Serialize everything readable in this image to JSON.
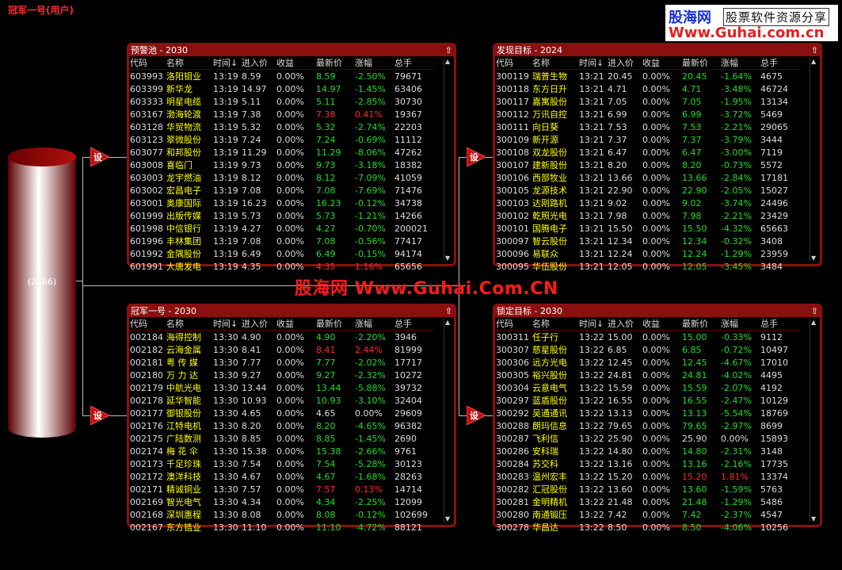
{
  "app_title": "冠军一号(用户)",
  "brand": {
    "name": "股海网",
    "slogan": "股票软件资源分享",
    "url": "Www.Guhai.com.cn"
  },
  "watermark": "股海网 Www.Guhai.Com.CN",
  "cylinder_count": "(2466)",
  "set_label": "设",
  "columns": [
    "代码",
    "名称",
    "时间↓",
    "进入价",
    "收益",
    "最新价",
    "涨幅",
    "总手"
  ],
  "panels": [
    {
      "title": "预警池 - 2030",
      "rows": [
        [
          "603993",
          "洛阳钼业",
          "13:19",
          "8.59",
          "0.00%",
          "8.59",
          "-2.50%",
          "79671"
        ],
        [
          "603399",
          "新华龙",
          "13:19",
          "14.97",
          "0.00%",
          "14.97",
          "-1.45%",
          "63406"
        ],
        [
          "603333",
          "明星电缆",
          "13:19",
          "5.11",
          "0.00%",
          "5.11",
          "-2.85%",
          "30730"
        ],
        [
          "603167",
          "渤海轮渡",
          "13:19",
          "7.38",
          "0.00%",
          "7.38",
          "0.41%",
          "19367"
        ],
        [
          "603128",
          "华贸物流",
          "13:19",
          "5.32",
          "0.00%",
          "5.32",
          "-2.74%",
          "22203"
        ],
        [
          "603123",
          "翠微股份",
          "13:19",
          "7.24",
          "0.00%",
          "7.24",
          "-0.69%",
          "11112"
        ],
        [
          "603077",
          "和邦股份",
          "13:19",
          "11.29",
          "0.00%",
          "11.29",
          "-8.06%",
          "47262"
        ],
        [
          "603008",
          "喜临门",
          "13:19",
          "9.73",
          "0.00%",
          "9.73",
          "-3.18%",
          "18382"
        ],
        [
          "603003",
          "龙宇燃油",
          "13:19",
          "8.12",
          "0.00%",
          "8.12",
          "-7.09%",
          "41059"
        ],
        [
          "603002",
          "宏昌电子",
          "13:19",
          "7.08",
          "0.00%",
          "7.08",
          "-7.69%",
          "71476"
        ],
        [
          "603001",
          "奥康国际",
          "13:19",
          "16.23",
          "0.00%",
          "16.23",
          "-0.12%",
          "34738"
        ],
        [
          "601999",
          "出版传媒",
          "13:19",
          "5.73",
          "0.00%",
          "5.73",
          "-1.21%",
          "14266"
        ],
        [
          "601998",
          "中信银行",
          "13:19",
          "4.27",
          "0.00%",
          "4.27",
          "-0.70%",
          "200021"
        ],
        [
          "601996",
          "丰林集团",
          "13:19",
          "7.08",
          "0.00%",
          "7.08",
          "-0.56%",
          "77417"
        ],
        [
          "601992",
          "金隅股份",
          "13:19",
          "6.49",
          "0.00%",
          "6.49",
          "-0.15%",
          "94174"
        ],
        [
          "601991",
          "大唐发电",
          "13:19",
          "4.35",
          "0.00%",
          "4.35",
          "1.16%",
          "65656"
        ]
      ]
    },
    {
      "title": "发现目标 - 2024",
      "rows": [
        [
          "300119",
          "瑞普生物",
          "13:21",
          "20.45",
          "0.00%",
          "20.45",
          "-1.64%",
          "4675"
        ],
        [
          "300118",
          "东方日升",
          "13:21",
          "4.71",
          "0.00%",
          "4.71",
          "-3.48%",
          "46724"
        ],
        [
          "300117",
          "嘉寓股份",
          "13:21",
          "7.05",
          "0.00%",
          "7.05",
          "-1.95%",
          "13134"
        ],
        [
          "300112",
          "万讯自控",
          "13:21",
          "6.99",
          "0.00%",
          "6.99",
          "-3.72%",
          "5469"
        ],
        [
          "300111",
          "向日葵",
          "13:21",
          "7.53",
          "0.00%",
          "7.53",
          "-2.21%",
          "29065"
        ],
        [
          "300109",
          "新开源",
          "13:21",
          "7.37",
          "0.00%",
          "7.37",
          "-3.79%",
          "3444"
        ],
        [
          "300108",
          "双龙股份",
          "13:21",
          "6.47",
          "0.00%",
          "6.47",
          "-3.00%",
          "7119"
        ],
        [
          "300107",
          "建新股份",
          "13:21",
          "8.20",
          "0.00%",
          "8.20",
          "-0.73%",
          "5572"
        ],
        [
          "300106",
          "西部牧业",
          "13:21",
          "13.66",
          "0.00%",
          "13.66",
          "-2.84%",
          "17181"
        ],
        [
          "300105",
          "龙源技术",
          "13:21",
          "22.90",
          "0.00%",
          "22.90",
          "-2.05%",
          "15027"
        ],
        [
          "300103",
          "达刚路机",
          "13:21",
          "9.02",
          "0.00%",
          "9.02",
          "-3.74%",
          "24496"
        ],
        [
          "300102",
          "乾照光电",
          "13:21",
          "7.98",
          "0.00%",
          "7.98",
          "-2.21%",
          "23429"
        ],
        [
          "300101",
          "国腾电子",
          "13:21",
          "15.50",
          "0.00%",
          "15.50",
          "-4.32%",
          "65663"
        ],
        [
          "300097",
          "智云股份",
          "13:21",
          "12.34",
          "0.00%",
          "12.34",
          "-0.32%",
          "3408"
        ],
        [
          "300096",
          "易联众",
          "13:21",
          "12.24",
          "0.00%",
          "12.24",
          "-1.29%",
          "23959"
        ],
        [
          "300095",
          "华伍股份",
          "13:21",
          "12.05",
          "0.00%",
          "12.05",
          "-3.45%",
          "3484"
        ]
      ]
    },
    {
      "title": "冠军一号 - 2030",
      "rows": [
        [
          "002184",
          "海得控制",
          "13:30",
          "4.90",
          "0.00%",
          "4.90",
          "-2.20%",
          "3946"
        ],
        [
          "002182",
          "云海金属",
          "13:30",
          "8.41",
          "0.00%",
          "8.41",
          "2.44%",
          "81999"
        ],
        [
          "002181",
          "粤 传 媒",
          "13:30",
          "7.77",
          "0.00%",
          "7.77",
          "-2.02%",
          "17717"
        ],
        [
          "002180",
          "万 力 达",
          "13:30",
          "9.27",
          "0.00%",
          "9.27",
          "-2.32%",
          "10272"
        ],
        [
          "002179",
          "中航光电",
          "13:30",
          "13.44",
          "0.00%",
          "13.44",
          "-5.88%",
          "39732"
        ],
        [
          "002178",
          "延华智能",
          "13:30",
          "10.93",
          "0.00%",
          "10.93",
          "-3.10%",
          "32404"
        ],
        [
          "002177",
          "御银股份",
          "13:30",
          "4.65",
          "0.00%",
          "4.65",
          "0.00%",
          "29609"
        ],
        [
          "002176",
          "江特电机",
          "13:30",
          "8.20",
          "0.00%",
          "8.20",
          "-4.65%",
          "96382"
        ],
        [
          "002175",
          "广陆数测",
          "13:30",
          "8.85",
          "0.00%",
          "8.85",
          "-1.45%",
          "2690"
        ],
        [
          "002174",
          "梅 花 伞",
          "13:30",
          "15.38",
          "0.00%",
          "15.38",
          "-2.66%",
          "9761"
        ],
        [
          "002173",
          "千足珍珠",
          "13:30",
          "7.54",
          "0.00%",
          "7.54",
          "-5.28%",
          "30123"
        ],
        [
          "002172",
          "澳洋科技",
          "13:30",
          "4.67",
          "0.00%",
          "4.67",
          "-1.68%",
          "28263"
        ],
        [
          "002171",
          "精诚铜业",
          "13:30",
          "7.57",
          "0.00%",
          "7.57",
          "0.13%",
          "14714"
        ],
        [
          "002169",
          "智光电气",
          "13:30",
          "4.34",
          "0.00%",
          "4.34",
          "-2.25%",
          "12099"
        ],
        [
          "002168",
          "深圳惠程",
          "13:30",
          "8.08",
          "0.00%",
          "8.08",
          "-0.12%",
          "102699"
        ],
        [
          "002167",
          "东方锆业",
          "13:30",
          "11.10",
          "0.00%",
          "11.10",
          "-4.72%",
          "88121"
        ]
      ]
    },
    {
      "title": "锁定目标 - 2030",
      "rows": [
        [
          "300311",
          "任子行",
          "13:22",
          "15.00",
          "0.00%",
          "15.00",
          "-0.33%",
          "9112"
        ],
        [
          "300307",
          "慈星股份",
          "13:22",
          "6.85",
          "0.00%",
          "6.85",
          "-0.72%",
          "10497"
        ],
        [
          "300306",
          "远方光电",
          "13:22",
          "12.45",
          "0.00%",
          "12.45",
          "-4.67%",
          "17010"
        ],
        [
          "300305",
          "裕兴股份",
          "13:22",
          "24.81",
          "0.00%",
          "24.81",
          "-4.02%",
          "4495"
        ],
        [
          "300304",
          "云意电气",
          "13:22",
          "15.59",
          "0.00%",
          "15.59",
          "-2.07%",
          "4192"
        ],
        [
          "300297",
          "蓝盾股份",
          "13:22",
          "16.55",
          "0.00%",
          "16.55",
          "-2.47%",
          "10129"
        ],
        [
          "300292",
          "吴通通讯",
          "13:22",
          "13.13",
          "0.00%",
          "13.13",
          "-5.54%",
          "18769"
        ],
        [
          "300288",
          "朗玛信息",
          "13:22",
          "79.65",
          "0.00%",
          "79.65",
          "-2.97%",
          "8699"
        ],
        [
          "300287",
          "飞利信",
          "13:22",
          "25.90",
          "0.00%",
          "25.90",
          "0.00%",
          "15893"
        ],
        [
          "300286",
          "安科瑞",
          "13:22",
          "14.80",
          "0.00%",
          "14.80",
          "-2.31%",
          "3148"
        ],
        [
          "300284",
          "苏交科",
          "13:22",
          "13.16",
          "0.00%",
          "13.16",
          "-2.16%",
          "17735"
        ],
        [
          "300283",
          "温州宏丰",
          "13:22",
          "15.20",
          "0.00%",
          "15.20",
          "1.81%",
          "13374"
        ],
        [
          "300282",
          "汇冠股份",
          "13:22",
          "13.60",
          "0.00%",
          "13.60",
          "-1.59%",
          "5763"
        ],
        [
          "300281",
          "金明精机",
          "13:22",
          "21.48",
          "0.00%",
          "21.48",
          "-1.29%",
          "5486"
        ],
        [
          "300280",
          "南通锻压",
          "13:22",
          "7.42",
          "0.00%",
          "7.42",
          "-2.37%",
          "4547"
        ],
        [
          "300278",
          "华昌达",
          "13:22",
          "8.50",
          "0.00%",
          "8.50",
          "-4.06%",
          "10256"
        ]
      ]
    }
  ]
}
